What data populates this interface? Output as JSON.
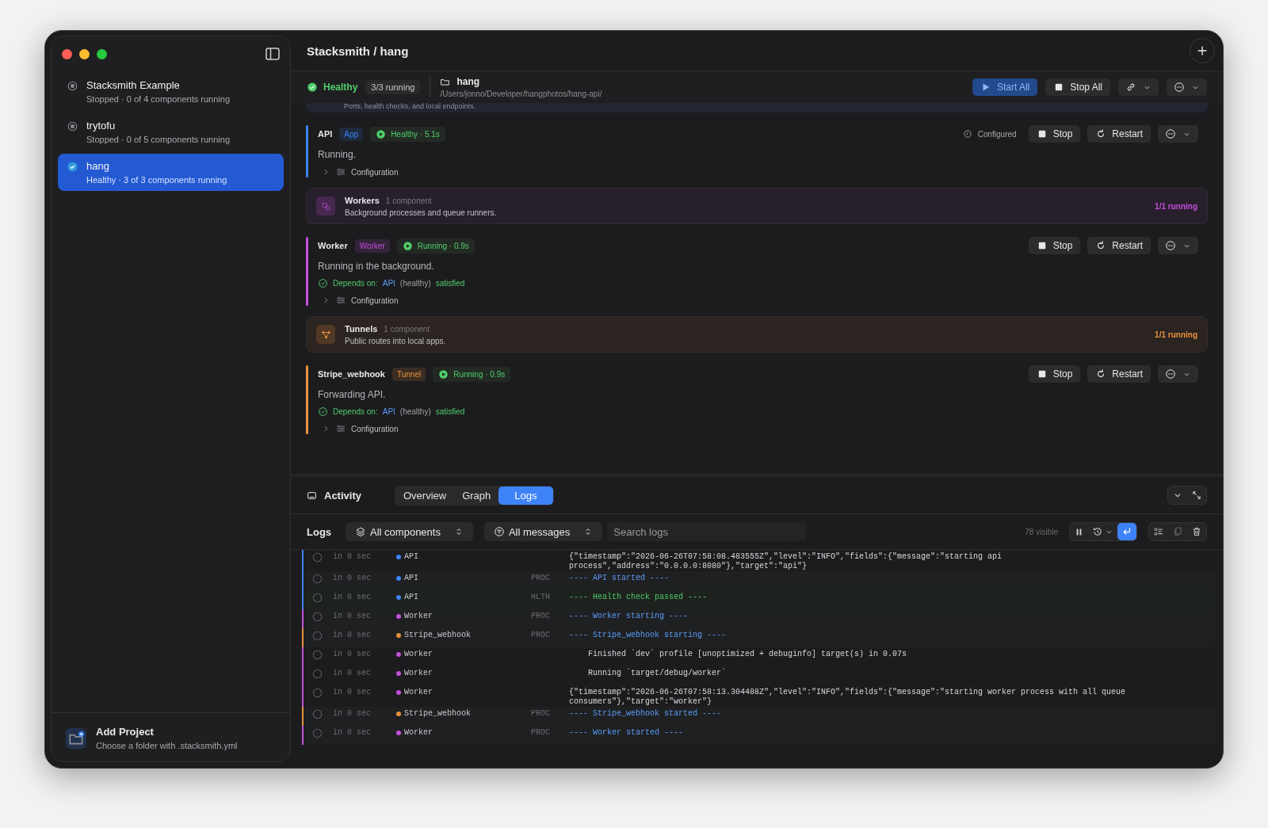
{
  "sidebar": {
    "projects": [
      {
        "name": "Stacksmith Example",
        "status": "Stopped · 0 of 4 components running",
        "selected": false
      },
      {
        "name": "trytofu",
        "status": "Stopped · 0 of 5 components running",
        "selected": false
      },
      {
        "name": "hang",
        "status": "Healthy · 3 of 3 components running",
        "selected": true
      }
    ],
    "add_project": {
      "title": "Add Project",
      "subtitle": "Choose a folder with .stacksmith.yml"
    }
  },
  "window": {
    "title": "Stacksmith / hang"
  },
  "status_bar": {
    "health": "Healthy",
    "running": "3/3 running",
    "folder": "hang",
    "path": "/Users/jonno/Developer/hangphotos/hang-api/",
    "buttons": [
      {
        "kind": "start",
        "label": "Start All"
      },
      {
        "kind": "stop",
        "label": "Stop All"
      }
    ]
  },
  "sections": [
    {
      "kind": "group-tail",
      "subtitle": "Ports, health checks, and local endpoints."
    },
    {
      "kind": "component",
      "name": "API",
      "type": "App",
      "status": "Healthy · 5.1s",
      "color": "#3b82f6",
      "configured": "Configured",
      "actions": [
        {
          "kind": "stop",
          "label": "Stop"
        },
        {
          "kind": "restart",
          "label": "Restart"
        }
      ],
      "description": "Running.",
      "config": "Configuration"
    },
    {
      "kind": "group",
      "title": "Workers",
      "count": "1 component",
      "subtitle": "Background processes and queue runners.",
      "running": "1/1 running",
      "color": "#c44fdc"
    },
    {
      "kind": "component",
      "name": "Worker",
      "type": "Worker",
      "status": "Running · 0.9s",
      "color": "#c44fdc",
      "actions": [
        {
          "kind": "stop",
          "label": "Stop"
        },
        {
          "kind": "restart",
          "label": "Restart"
        }
      ],
      "description": "Running in the background.",
      "depends": {
        "label": "Depends on:",
        "target": "API",
        "condition": "(healthy)",
        "result": "satisfied"
      },
      "config": "Configuration"
    },
    {
      "kind": "group",
      "title": "Tunnels",
      "count": "1 component",
      "subtitle": "Public routes into local apps.",
      "running": "1/1 running",
      "color": "#e9923a"
    },
    {
      "kind": "component",
      "name": "Stripe_webhook",
      "type": "Tunnel",
      "status": "Running · 0.9s",
      "color": "#e9923a",
      "actions": [
        {
          "kind": "stop",
          "label": "Stop"
        },
        {
          "kind": "restart",
          "label": "Restart"
        }
      ],
      "description": "Forwarding API.",
      "depends": {
        "label": "Depends on:",
        "target": "API",
        "condition": "(healthy)",
        "result": "satisfied"
      },
      "config": "Configuration"
    }
  ],
  "activity": {
    "title": "Activity",
    "tabs": [
      {
        "label": "Overview",
        "selected": false
      },
      {
        "label": "Graph",
        "selected": false
      },
      {
        "label": "Logs",
        "selected": true
      }
    ]
  },
  "logs": {
    "title": "Logs",
    "component_filter": "All components",
    "message_filter": "All messages",
    "search": {
      "placeholder": "Search logs"
    },
    "count": "78 visible",
    "wrap": true,
    "rows": [
      {
        "time": "in 0 sec",
        "source": "API",
        "color": "#3b82f6",
        "kind": "json",
        "message": "{\"timestamp\":\"2026-06-26T07:58:08.483555Z\",\"level\":\"INFO\",\"fields\":{\"message\":\"starting api process\",\"address\":\"0.0.0.0:8080\"},\"target\":\"api\"}"
      },
      {
        "time": "in 0 sec",
        "source": "API",
        "color": "#3b82f6",
        "kind": "proc",
        "tag": "PROC",
        "message": "---- API started ----"
      },
      {
        "time": "in 0 sec",
        "source": "API",
        "color": "#3b82f6",
        "kind": "health",
        "tag": "HLTH",
        "message": "---- Health check passed ----"
      },
      {
        "time": "in 0 sec",
        "source": "Worker",
        "color": "#c44fdc",
        "kind": "proc",
        "tag": "PROC",
        "message": "---- Worker starting ----"
      },
      {
        "time": "in 0 sec",
        "source": "Stripe_webhook",
        "color": "#e9923a",
        "kind": "proc",
        "tag": "PROC",
        "message": "---- Stripe_webhook starting ----"
      },
      {
        "time": "in 0 sec",
        "source": "Worker",
        "color": "#c44fdc",
        "kind": "output",
        "message": "Finished `dev` profile [unoptimized + debuginfo] target(s) in 0.07s"
      },
      {
        "time": "in 0 sec",
        "source": "Worker",
        "color": "#c44fdc",
        "kind": "output",
        "message": "Running `target/debug/worker`"
      },
      {
        "time": "in 0 sec",
        "source": "Worker",
        "color": "#c44fdc",
        "kind": "json",
        "message": "{\"timestamp\":\"2026-06-26T07:58:13.304488Z\",\"level\":\"INFO\",\"fields\":{\"message\":\"starting worker process with all queue consumers\"},\"target\":\"worker\"}"
      },
      {
        "time": "in 0 sec",
        "source": "Stripe_webhook",
        "color": "#e9923a",
        "kind": "proc",
        "tag": "PROC",
        "message": "---- Stripe_webhook started ----"
      },
      {
        "time": "in 0 sec",
        "source": "Worker",
        "color": "#c44fdc",
        "kind": "proc",
        "tag": "PROC",
        "message": "---- Worker started ----"
      }
    ]
  }
}
